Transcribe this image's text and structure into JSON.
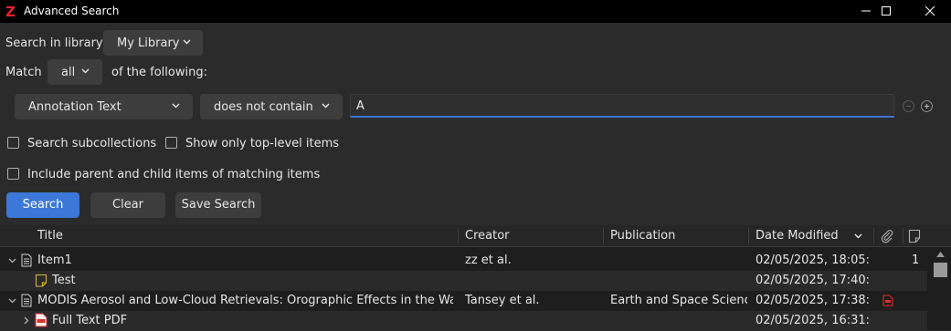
{
  "window": {
    "title": "Advanced Search",
    "minimize_icon": "minimize-icon",
    "maximize_icon": "maximize-icon",
    "close_icon": "close-icon"
  },
  "search": {
    "library_label": "Search in library:",
    "library_value": "My Library",
    "match_label": "Match",
    "match_value": "all",
    "match_suffix": "of the following:",
    "condition": {
      "field": "Annotation Text",
      "operator": "does not contain",
      "value": "A"
    },
    "options": {
      "subcollections": {
        "label": "Search subcollections",
        "checked": false
      },
      "top_level": {
        "label": "Show only top-level items",
        "checked": false
      },
      "parent_child": {
        "label": "Include parent and child items of matching items",
        "checked": false
      }
    },
    "buttons": {
      "search": "Search",
      "clear": "Clear",
      "save": "Save Search"
    }
  },
  "results": {
    "columns": [
      "Title",
      "Creator",
      "Publication",
      "Date Modified"
    ],
    "sort_column": "Date Modified",
    "rows": [
      {
        "title": "Item1",
        "creator": "zz et al.",
        "publication": "",
        "date": "02/05/2025, 18:05:...",
        "notes": "1",
        "expanded": true,
        "level": 0,
        "icon": "document-icon"
      },
      {
        "title": "Test",
        "creator": "",
        "publication": "",
        "date": "02/05/2025, 17:40:...",
        "notes": "",
        "level": 1,
        "icon": "note-icon"
      },
      {
        "title": "MODIS Aerosol and Low-Cloud Retrievals: Orographic Effects in the Wake o...",
        "creator": "Tansey et al.",
        "publication": "Earth and Space Science",
        "date": "02/05/2025, 17:38:...",
        "notes": "",
        "expanded": true,
        "level": 0,
        "icon": "document-icon",
        "attachment": "pdf-icon"
      },
      {
        "title": "Full Text PDF",
        "creator": "",
        "publication": "",
        "date": "02/05/2025, 16:31:...",
        "notes": "",
        "expanded": false,
        "level": 1,
        "icon": "pdf-icon"
      }
    ]
  },
  "colors": {
    "accent": "#3d77d8",
    "brand": "#e8232b",
    "pdf": "#d9302c"
  }
}
